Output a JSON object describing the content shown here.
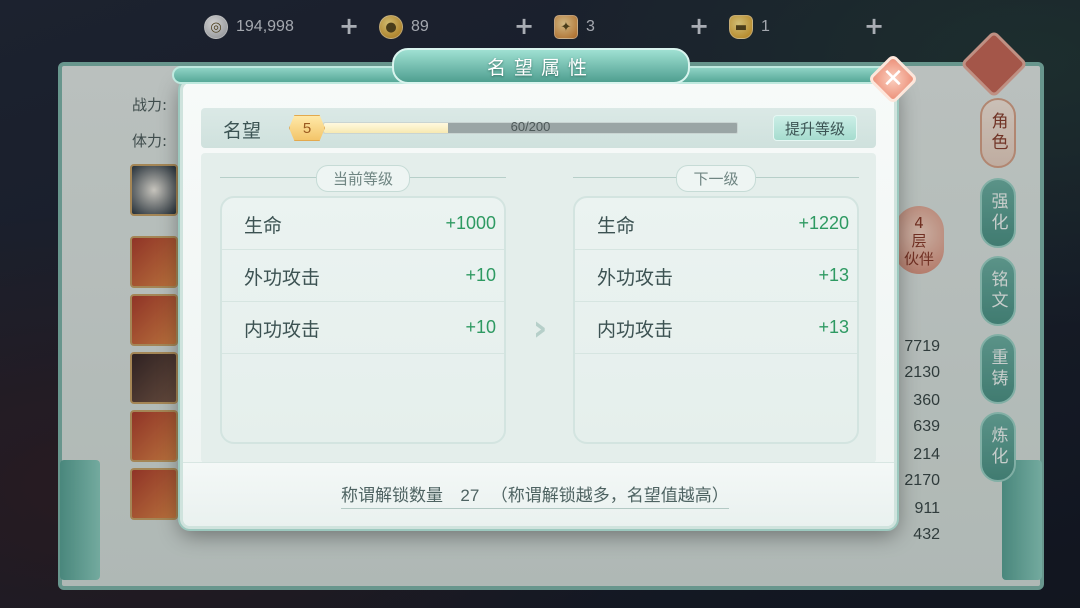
{
  "currency": [
    {
      "icon": "silver-coin-icon",
      "value": "194,998"
    },
    {
      "icon": "gold-coin-icon",
      "value": "89"
    },
    {
      "icon": "ticket-icon",
      "value": "3"
    },
    {
      "icon": "gold-ingot-icon",
      "value": "1"
    }
  ],
  "background": {
    "combat_label": "战力:",
    "stamina_label": "体力:",
    "partner_badge": "4\n层\n伙伴",
    "numbers": [
      "7719",
      "2130",
      "360",
      "639",
      "214",
      "2170",
      "911",
      "432"
    ],
    "side_tabs": [
      "角色",
      "强化",
      "铭文",
      "重铸",
      "炼化"
    ]
  },
  "modal": {
    "title": "名望属性",
    "reputation": {
      "label": "名望",
      "level": "5",
      "current": 60,
      "max": 200,
      "progress_text": "60/200",
      "upgrade_label": "提升等级"
    },
    "current_level": {
      "heading": "当前等级",
      "attributes": [
        {
          "name": "生命",
          "value": "+1000"
        },
        {
          "name": "外功攻击",
          "value": "+10"
        },
        {
          "name": "内功攻击",
          "value": "+10"
        }
      ]
    },
    "next_level": {
      "heading": "下一级",
      "attributes": [
        {
          "name": "生命",
          "value": "+1220"
        },
        {
          "name": "外功攻击",
          "value": "+13"
        },
        {
          "name": "内功攻击",
          "value": "+13"
        }
      ]
    },
    "footer": {
      "unlock_label": "称谓解锁数量",
      "unlock_count": "27",
      "unlock_hint": "（称谓解锁越多，名望值越高）"
    }
  },
  "colors": {
    "accent": "#57a898",
    "positive_value": "#2e9a62",
    "close_button": "#ec8f78"
  }
}
